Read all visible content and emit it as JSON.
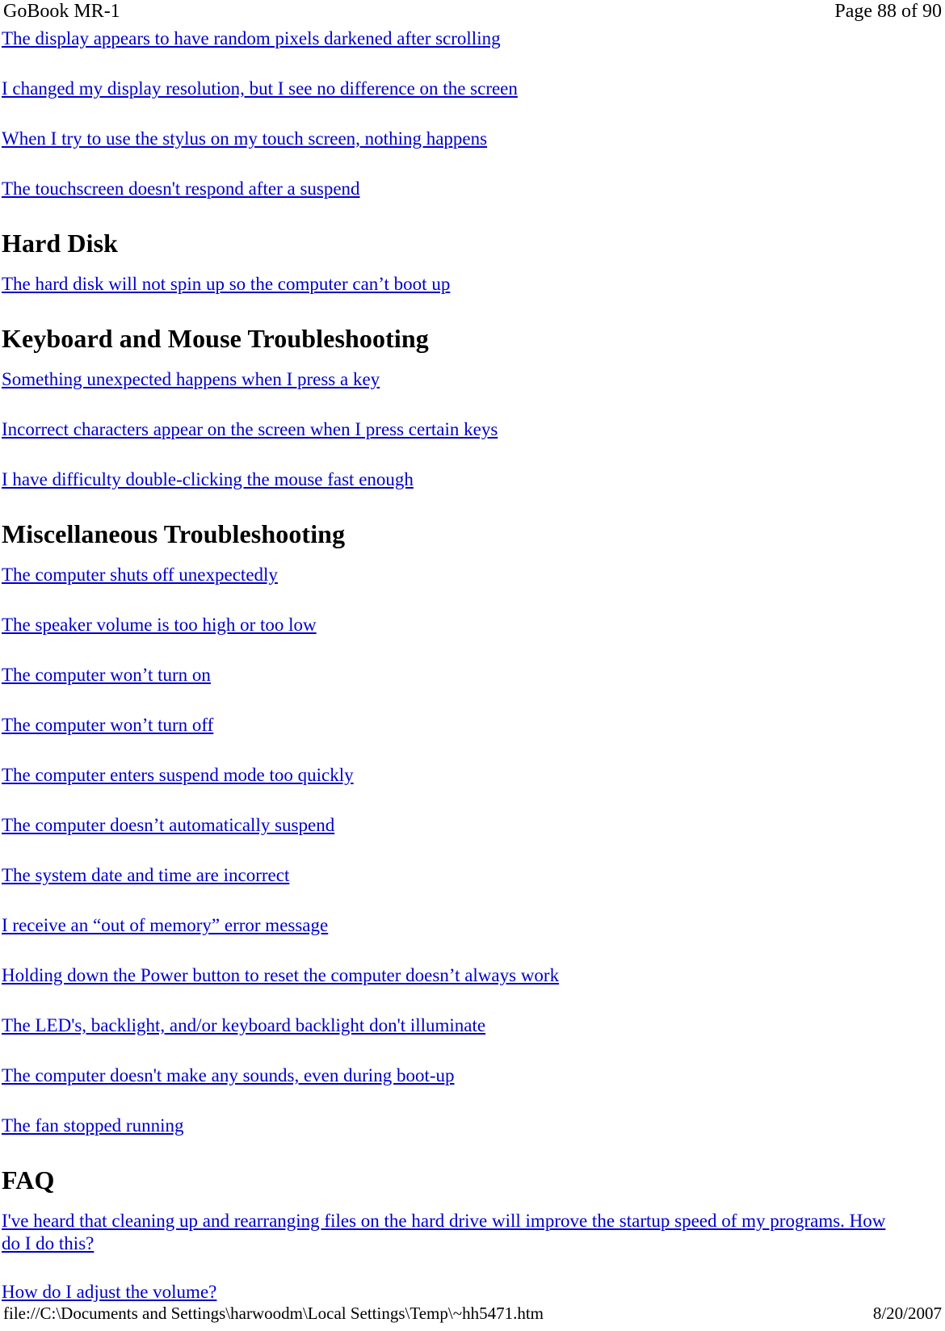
{
  "header": {
    "title": "GoBook MR-1",
    "page_indicator": "Page 88 of 90"
  },
  "footer": {
    "file_path": "file://C:\\Documents and Settings\\harwoodm\\Local Settings\\Temp\\~hh5471.htm",
    "date": "8/20/2007"
  },
  "colors": {
    "link": "#0000CC",
    "text": "#000000",
    "background": "#FFFFFF"
  },
  "content": {
    "top_links": [
      "The display appears to have random pixels darkened after scrolling",
      "I changed my display resolution, but I see no difference on the screen",
      "When I try to use the stylus on my touch screen, nothing happens",
      "The touchscreen doesn't respond after a suspend"
    ],
    "sections": [
      {
        "heading": "Hard Disk",
        "links": [
          "The hard disk will not spin up so the computer can’t boot up"
        ]
      },
      {
        "heading": "Keyboard and Mouse Troubleshooting",
        "links": [
          "Something unexpected happens when I press a key",
          "Incorrect characters appear on the screen when I press certain keys",
          "I have difficulty double-clicking the mouse fast enough"
        ]
      },
      {
        "heading": "Miscellaneous Troubleshooting",
        "links": [
          "The computer shuts off unexpectedly",
          "The speaker volume is too high or too low",
          "The computer won’t turn on",
          "The computer won’t turn off",
          "The computer enters suspend mode too quickly",
          "The computer doesn’t automatically suspend",
          "The system date and time are incorrect",
          "I receive an “out of memory” error message",
          "Holding down the Power button to reset the computer doesn’t always work",
          "The LED's, backlight, and/or keyboard backlight don't illuminate",
          "The computer doesn't make any sounds, even during boot-up",
          "The fan stopped running"
        ]
      },
      {
        "heading": "FAQ",
        "links": [
          "I've heard that cleaning up and rearranging files on the hard drive will improve the startup speed of my programs. How do I do this?",
          "How do I adjust the volume?"
        ]
      }
    ]
  }
}
